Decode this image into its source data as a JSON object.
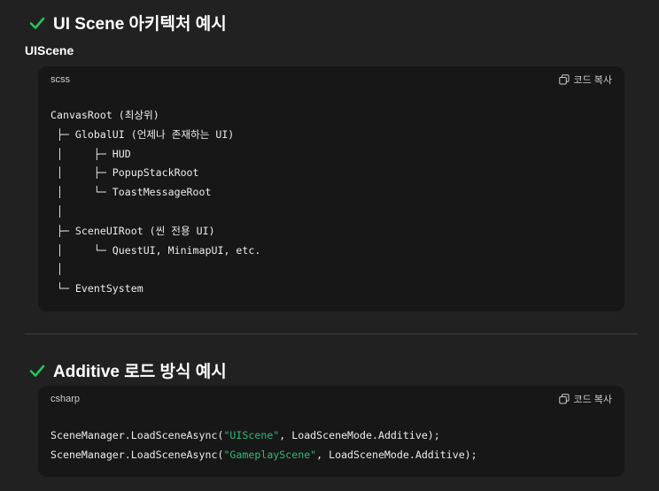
{
  "section1": {
    "title": "UI Scene 아키텍처 예시",
    "subtitle": "UIScene",
    "code": {
      "language": "scss",
      "copy_label": "코드 복사",
      "lines": [
        "CanvasRoot (최상위)",
        " ├─ GlobalUI (언제나 존재하는 UI)",
        " │     ├─ HUD",
        " │     ├─ PopupStackRoot",
        " │     └─ ToastMessageRoot",
        " │",
        " ├─ SceneUIRoot (씬 전용 UI)",
        " │     └─ QuestUI, MinimapUI, etc.",
        " │",
        " └─ EventSystem"
      ]
    }
  },
  "section2": {
    "title": "Additive 로드 방식 예시",
    "code": {
      "language": "csharp",
      "copy_label": "코드 복사",
      "line1": {
        "pre": "SceneManager.LoadSceneAsync(",
        "str": "\"UIScene\"",
        "post": ", LoadSceneMode.Additive);"
      },
      "line2": {
        "pre": "SceneManager.LoadSceneAsync(",
        "str": "\"GameplayScene\"",
        "post": ", LoadSceneMode.Additive);"
      }
    }
  },
  "colors": {
    "background": "#212121",
    "code_background": "#171717",
    "check": "#22c55e",
    "string": "#2fb87a"
  }
}
